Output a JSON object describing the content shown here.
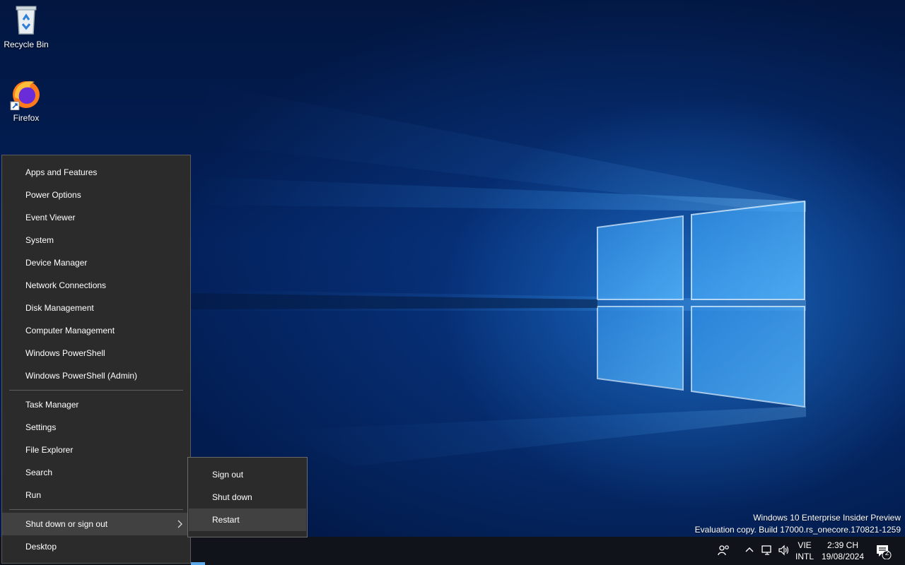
{
  "desktop": {
    "icons": [
      {
        "label": "Recycle Bin",
        "icon": "recycle-bin-icon"
      },
      {
        "label": "Firefox",
        "icon": "firefox-icon"
      }
    ],
    "watermark": {
      "line1": "Windows 10 Enterprise Insider Preview",
      "line2": "Evaluation copy. Build 17000.rs_onecore.170821-1259"
    }
  },
  "winx_menu": {
    "group1": [
      "Apps and Features",
      "Power Options",
      "Event Viewer",
      "System",
      "Device Manager",
      "Network Connections",
      "Disk Management",
      "Computer Management",
      "Windows PowerShell",
      "Windows PowerShell (Admin)"
    ],
    "group2": [
      "Task Manager",
      "Settings",
      "File Explorer",
      "Search",
      "Run"
    ],
    "group3": [
      "Shut down or sign out",
      "Desktop"
    ]
  },
  "submenu": {
    "items": [
      "Sign out",
      "Shut down",
      "Restart"
    ],
    "highlighted": "Restart"
  },
  "taskbar": {
    "ime_line1": "VIE",
    "ime_line2": "INTL",
    "time": "2:39 CH",
    "date": "19/08/2024",
    "notification_count": "2",
    "tray_icons": [
      "people-icon",
      "show-hidden-icons-chevron",
      "network-icon",
      "volume-icon",
      "action-center-icon"
    ]
  },
  "colors": {
    "menu_bg": "#2b2b2b",
    "menu_highlight": "#414141",
    "taskbar_bg": "#10131a",
    "accent": "#5aa7ea"
  }
}
